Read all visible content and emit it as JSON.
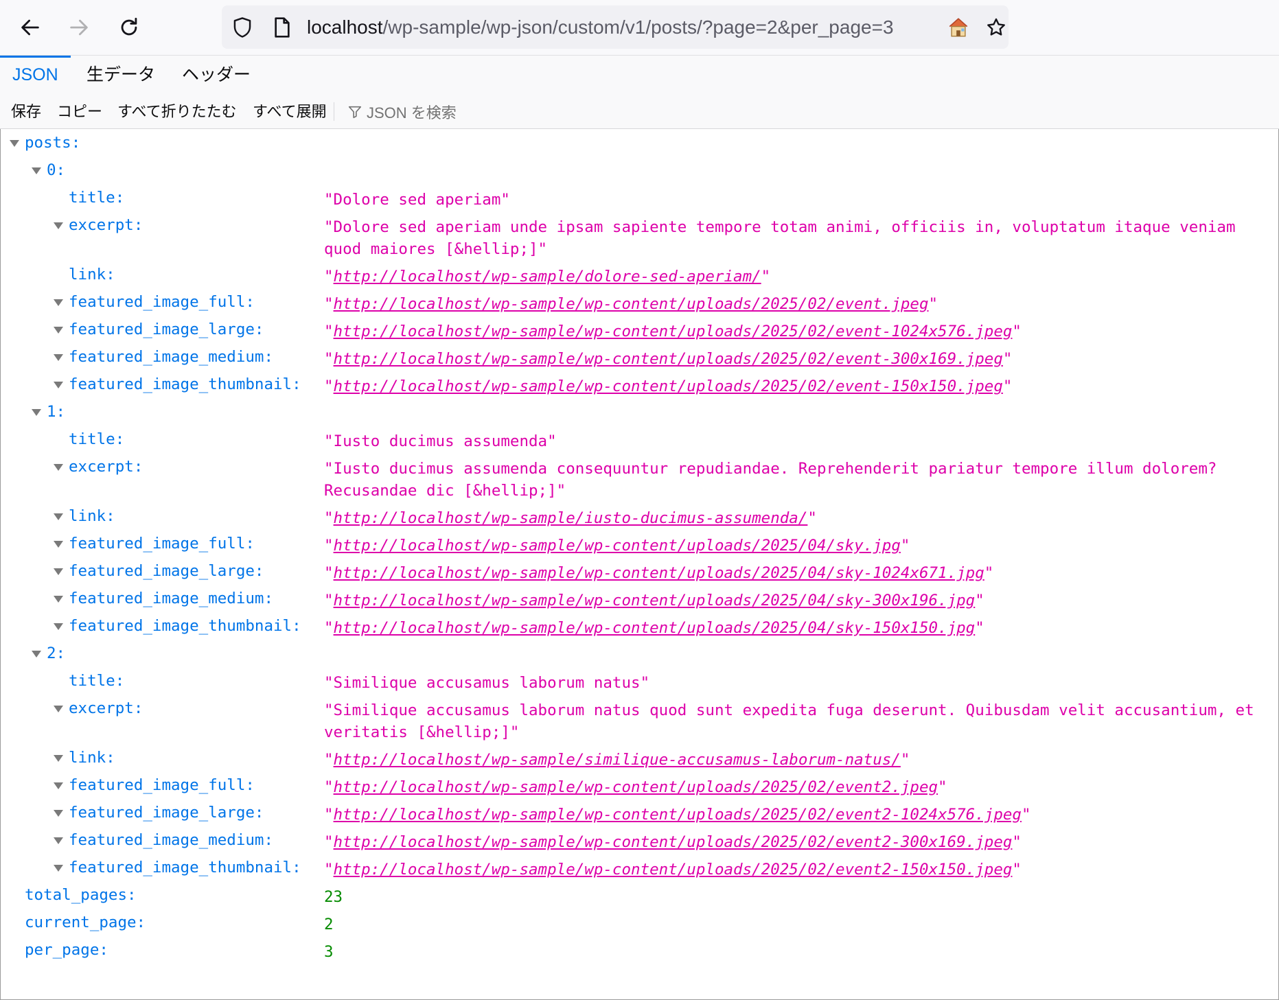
{
  "browser": {
    "url_host": "localhost",
    "url_path": "/wp-sample/wp-json/custom/v1/posts/?page=2&per_page=3"
  },
  "viewer": {
    "tabs": [
      "JSON",
      "生データ",
      "ヘッダー"
    ],
    "toolbar": {
      "save": "保存",
      "copy": "コピー",
      "collapse_all": "すべて折りたたむ",
      "expand_all": "すべて展開",
      "filter_placeholder": "JSON を検索"
    }
  },
  "json": {
    "root_key": "posts:",
    "posts": [
      {
        "index": "0:",
        "title": "\"Dolore sed aperiam\"",
        "excerpt": "\"Dolore sed aperiam unde ipsam sapiente tempore totam animi, officiis in, voluptatum itaque veniam quod maiores [&hellip;]\"",
        "link": "http://localhost/wp-sample/dolore-sed-aperiam/",
        "featured_image_full": "http://localhost/wp-sample/wp-content/uploads/2025/02/event.jpeg",
        "featured_image_large": "http://localhost/wp-sample/wp-content/uploads/2025/02/event-1024x576.jpeg",
        "featured_image_medium": "http://localhost/wp-sample/wp-content/uploads/2025/02/event-300x169.jpeg",
        "featured_image_thumbnail": "http://localhost/wp-sample/wp-content/uploads/2025/02/event-150x150.jpeg"
      },
      {
        "index": "1:",
        "title": "\"Iusto ducimus assumenda\"",
        "excerpt": "\"Iusto ducimus assumenda consequuntur repudiandae. Reprehenderit pariatur tempore illum dolorem? Recusandae dic [&hellip;]\"",
        "link": "http://localhost/wp-sample/iusto-ducimus-assumenda/",
        "featured_image_full": "http://localhost/wp-sample/wp-content/uploads/2025/04/sky.jpg",
        "featured_image_large": "http://localhost/wp-sample/wp-content/uploads/2025/04/sky-1024x671.jpg",
        "featured_image_medium": "http://localhost/wp-sample/wp-content/uploads/2025/04/sky-300x196.jpg",
        "featured_image_thumbnail": "http://localhost/wp-sample/wp-content/uploads/2025/04/sky-150x150.jpg"
      },
      {
        "index": "2:",
        "title": "\"Similique accusamus laborum natus\"",
        "excerpt": "\"Similique accusamus laborum natus quod sunt expedita fuga deserunt. Quibusdam velit accusantium, et veritatis  [&hellip;]\"",
        "link": "http://localhost/wp-sample/similique-accusamus-laborum-natus/",
        "featured_image_full": "http://localhost/wp-sample/wp-content/uploads/2025/02/event2.jpeg",
        "featured_image_large": "http://localhost/wp-sample/wp-content/uploads/2025/02/event2-1024x576.jpeg",
        "featured_image_medium": "http://localhost/wp-sample/wp-content/uploads/2025/02/event2-300x169.jpeg",
        "featured_image_thumbnail": "http://localhost/wp-sample/wp-content/uploads/2025/02/event2-150x150.jpeg"
      }
    ],
    "keys": {
      "title": "title:",
      "excerpt": "excerpt:",
      "link": "link:",
      "featured_image_full": "featured_image_full:",
      "featured_image_large": "featured_image_large:",
      "featured_image_medium": "featured_image_medium:",
      "featured_image_thumbnail": "featured_image_thumbnail:"
    },
    "total_pages_key": "total_pages:",
    "total_pages": "23",
    "current_page_key": "current_page:",
    "current_page": "2",
    "per_page_key": "per_page:",
    "per_page": "3"
  },
  "colors": {
    "key": "#0074e8",
    "string": "#dd00a9",
    "number": "#058b00",
    "accent": "#0074e8"
  }
}
